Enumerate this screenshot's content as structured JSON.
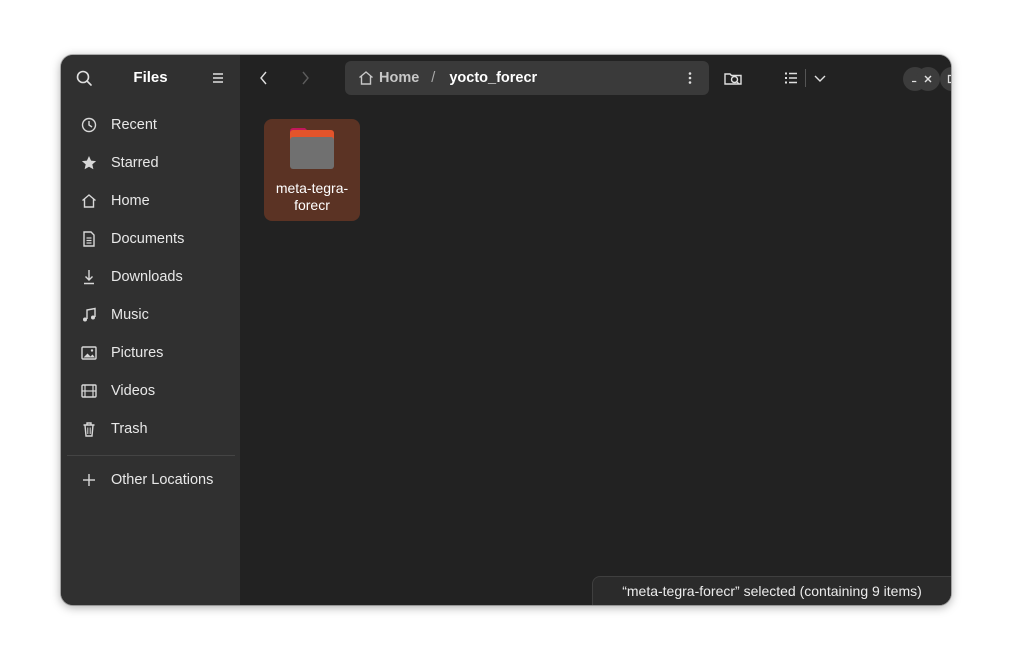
{
  "app": {
    "title": "Files"
  },
  "sidebar": {
    "items": [
      {
        "label": "Recent",
        "icon": "clock-icon"
      },
      {
        "label": "Starred",
        "icon": "star-icon"
      },
      {
        "label": "Home",
        "icon": "home-icon"
      },
      {
        "label": "Documents",
        "icon": "document-icon"
      },
      {
        "label": "Downloads",
        "icon": "download-icon"
      },
      {
        "label": "Music",
        "icon": "music-icon"
      },
      {
        "label": "Pictures",
        "icon": "picture-icon"
      },
      {
        "label": "Videos",
        "icon": "video-icon"
      },
      {
        "label": "Trash",
        "icon": "trash-icon"
      }
    ],
    "other_locations": {
      "label": "Other Locations",
      "icon": "plus-icon"
    }
  },
  "pathbar": {
    "home_label": "Home",
    "separator": "/",
    "current": "yocto_forecr"
  },
  "files": [
    {
      "name": "meta-tegra-forecr",
      "type": "folder",
      "selected": true
    }
  ],
  "status": {
    "text": "“meta-tegra-forecr” selected  (containing 9 items)"
  },
  "colors": {
    "accent_selection": "#5b3324",
    "folder_tab": "#c2185b",
    "folder_body": "#707070",
    "sidebar_bg": "#303030",
    "content_bg": "#222222"
  }
}
